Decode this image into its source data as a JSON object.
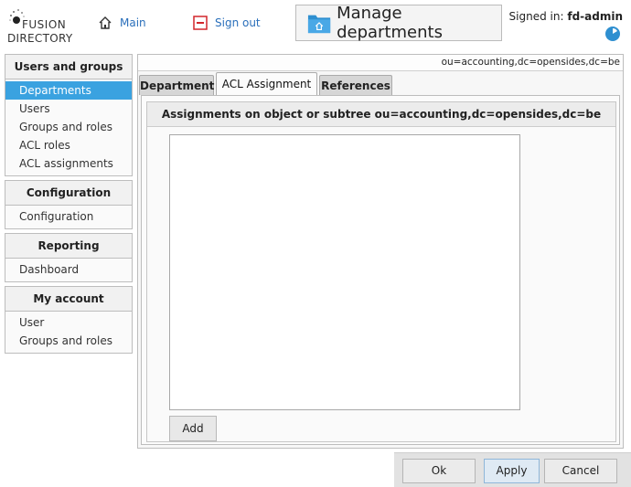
{
  "header": {
    "logo_line1": "FUSION",
    "logo_line2": "DIRECTORY",
    "main_link": "Main",
    "signout_link": "Sign out",
    "page_title": "Manage departments",
    "signed_in_label": "Signed in:",
    "signed_in_user": "fd-admin"
  },
  "sidebar": {
    "groups": [
      {
        "title": "Users and groups",
        "items": [
          "Departments",
          "Users",
          "Groups and roles",
          "ACL roles",
          "ACL assignments"
        ]
      },
      {
        "title": "Configuration",
        "items": [
          "Configuration"
        ]
      },
      {
        "title": "Reporting",
        "items": [
          "Dashboard"
        ]
      },
      {
        "title": "My account",
        "items": [
          "User",
          "Groups and roles"
        ]
      }
    ],
    "active_item": "Departments"
  },
  "main": {
    "dn": "ou=accounting,dc=opensides,dc=be",
    "tabs": [
      "Department",
      "ACL Assignment",
      "References"
    ],
    "active_tab": "ACL Assignment",
    "assignment_title": "Assignments on object or subtree ou=accounting,dc=opensides,dc=be",
    "add_label": "Add"
  },
  "footer": {
    "ok_label": "Ok",
    "apply_label": "Apply",
    "cancel_label": "Cancel"
  },
  "colors": {
    "accent": "#3aa2e0",
    "link": "#2a6fbb",
    "signout_red": "#d2262b"
  }
}
